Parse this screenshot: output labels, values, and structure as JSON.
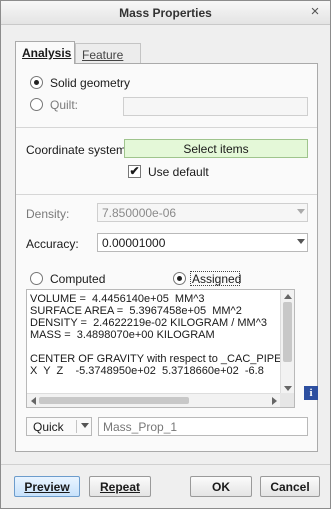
{
  "window": {
    "title": "Mass Properties",
    "close_glyph": "×"
  },
  "tabs": [
    {
      "label": "Analysis",
      "active": true
    },
    {
      "label": "Feature",
      "active": false
    }
  ],
  "geometry": {
    "solid_label": "Solid geometry",
    "quilt_label": "Quilt:",
    "selected": "solid"
  },
  "coordinate_system": {
    "label": "Coordinate system:",
    "button_label": "Select items",
    "use_default_label": "Use default",
    "use_default_checked": true,
    "check_glyph": "✔"
  },
  "density": {
    "label": "Density:",
    "value": "7.850000e-06"
  },
  "accuracy": {
    "label": "Accuracy:",
    "value": "0.00001000"
  },
  "mode": {
    "computed_label": "Computed",
    "assigned_label": "Assigned",
    "selected": "assigned"
  },
  "results": {
    "text": "VOLUME =  4.4456140e+05  MM^3\nSURFACE AREA =  5.3967458e+05  MM^2\nDENSITY =  2.4622219e-02 KILOGRAM / MM^3\nMASS =  3.4898070e+00 KILOGRAM\n\nCENTER OF GRAVITY with respect to _CAC_PIPE\nX  Y  Z    -5.3748950e+02  5.3718660e+02  -6.8"
  },
  "info_icon": {
    "name": "info-icon",
    "glyph": "i"
  },
  "save": {
    "type_value": "Quick",
    "name_value": "Mass_Prop_1"
  },
  "buttons": {
    "preview": "Preview",
    "repeat": "Repeat",
    "ok": "OK",
    "cancel": "Cancel"
  },
  "colors": {
    "select_items_bg": "#e4f8d8",
    "info_icon": "#2d4fa0",
    "preview_bg": "#c8e2fb"
  }
}
